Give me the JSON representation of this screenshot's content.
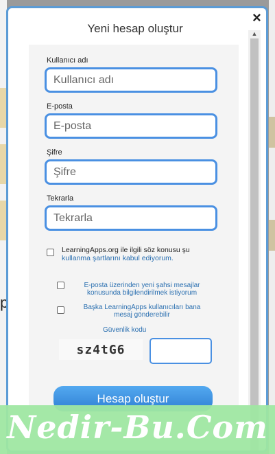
{
  "modal": {
    "title": "Yeni hesap oluştur",
    "close_label": "×",
    "fields": [
      {
        "label": "Kullanıcı adı",
        "placeholder": "Kullanıcı adı"
      },
      {
        "label": "E-posta",
        "placeholder": "E-posta"
      },
      {
        "label": "Şifre",
        "placeholder": "Şifre"
      },
      {
        "label": "Tekrarla",
        "placeholder": "Tekrarla"
      }
    ],
    "terms": {
      "text": "LearningApps.org ile ilgili söz konusu şu",
      "link": "kullanma şartlarını kabul ediyorum",
      "tail": "."
    },
    "options": [
      "E-posta üzerinden yeni şahsi mesajlar konusunda bilgilendirilmek istiyorum",
      "Başka LearningApps kullanıcıları bana mesaj gönderebilir"
    ],
    "security_label": "Güvenlik kodu",
    "captcha_text": "sz4tG6",
    "submit_label": "Hesap oluştur"
  },
  "watermark": "Nedir-Bu.Com",
  "background": {
    "fragment_char": "p"
  },
  "colors": {
    "accent": "#4a90e2",
    "link": "#2a6fb0",
    "watermark_bg": "#9fe7a2"
  }
}
